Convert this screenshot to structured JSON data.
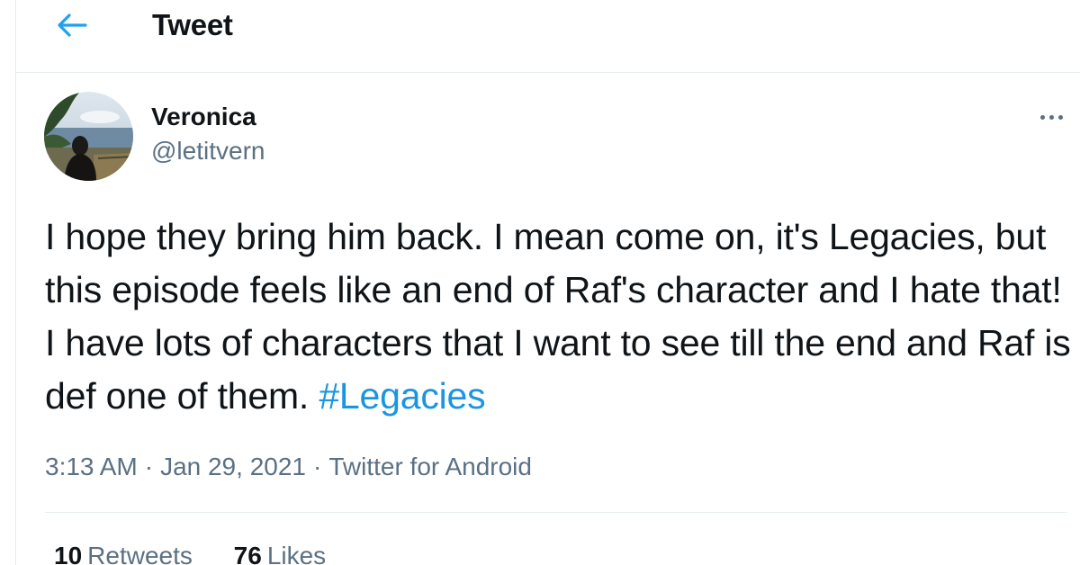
{
  "header": {
    "title": "Tweet",
    "back_icon": "back-arrow-icon"
  },
  "author": {
    "name": "Veronica",
    "handle": "@letitvern",
    "more_icon": "more-options-icon"
  },
  "tweet": {
    "text": "I hope they bring him back. I mean come on, it's Legacies, but this episode feels like an end of Raf's character and I hate that! I have lots of characters that I want to see till the end and Raf is def one of them.",
    "hashtag": "#Legacies"
  },
  "meta": {
    "time": "3:13 AM",
    "date": "Jan 29, 2021",
    "separator": "·",
    "source": "Twitter for Android"
  },
  "stats": {
    "retweets_count": "10",
    "retweets_label": "Retweets",
    "likes_count": "76",
    "likes_label": "Likes"
  },
  "colors": {
    "accent": "#1da1f2",
    "link": "#1b95e0",
    "secondary_text": "#5b7083",
    "border": "#e6ecf0"
  }
}
